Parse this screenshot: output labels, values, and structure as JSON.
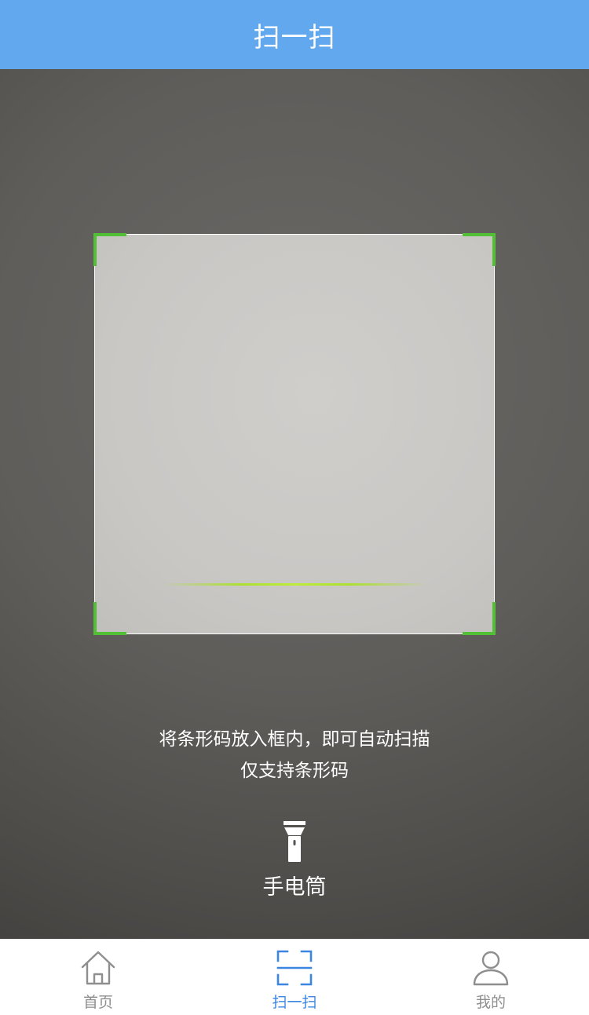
{
  "header": {
    "title": "扫一扫"
  },
  "scanner": {
    "hint_line1": "将条形码放入框内，即可自动扫描",
    "hint_line2": "仅支持条形码",
    "frame_corner_color": "#52c034",
    "scan_line_color": "#aee12a"
  },
  "flashlight": {
    "label": "手电筒",
    "icon": "flashlight-icon"
  },
  "tabbar": {
    "active_color": "#3a86e0",
    "inactive_color": "#8e8e8e",
    "items": [
      {
        "label": "首页",
        "icon": "home-icon",
        "active": false
      },
      {
        "label": "扫一扫",
        "icon": "scan-icon",
        "active": true
      },
      {
        "label": "我的",
        "icon": "user-icon",
        "active": false
      }
    ]
  },
  "colors": {
    "header_bg": "#61a8ef"
  }
}
